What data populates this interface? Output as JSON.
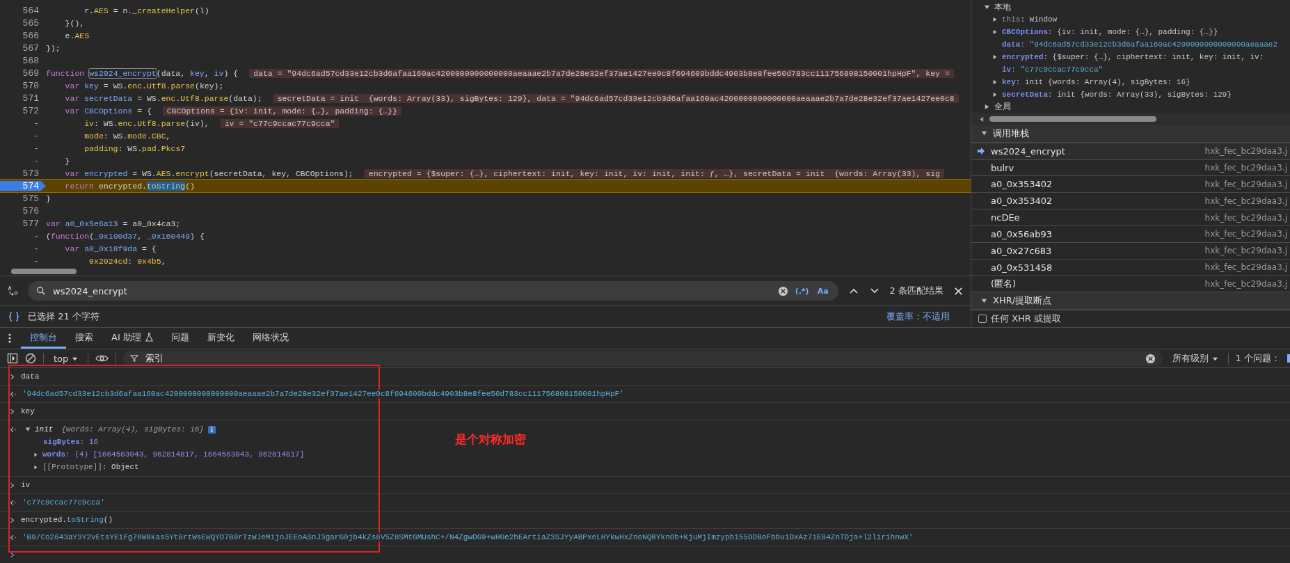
{
  "editor": {
    "lines": [
      {
        "number": "564",
        "paused": false,
        "segments": [
          {
            "text": "        r.",
            "kind": "plain"
          },
          {
            "text": "AES",
            "kind": "member"
          },
          {
            "text": " = n.",
            "kind": "plain"
          },
          {
            "text": "_createHelper",
            "kind": "member"
          },
          {
            "text": "(l)",
            "kind": "plain"
          }
        ]
      },
      {
        "number": "565",
        "paused": false,
        "segments": [
          {
            "text": "    }(),",
            "kind": "plain"
          }
        ]
      },
      {
        "number": "566",
        "paused": false,
        "segments": [
          {
            "text": "    e.",
            "kind": "plain"
          },
          {
            "text": "AES",
            "kind": "member"
          }
        ]
      },
      {
        "number": "567",
        "paused": false,
        "segments": [
          {
            "text": "});",
            "kind": "plain"
          }
        ]
      },
      {
        "number": "568",
        "paused": false
      },
      {
        "number": "569",
        "paused": false,
        "segments": [
          {
            "text": "function ",
            "kind": "keyword"
          },
          {
            "text": "ws2024_encrypt",
            "kind": "cursor"
          },
          {
            "text": "(data, ",
            "kind": "plain"
          },
          {
            "text": "key",
            "kind": "name"
          },
          {
            "text": ", ",
            "kind": "plain"
          },
          {
            "text": "iv",
            "kind": "name"
          },
          {
            "text": ") {",
            "kind": "plain"
          }
        ],
        "inline_value": "data = \"94dc6ad57cd33e12cb3d6afaa160ac4200000000000000aeaaae2b7a7de28e32ef37ae1427ee0c8f694609bddc4903b8e8fee50d783cc111756808150001hpHpF\", key ="
      },
      {
        "number": "570",
        "paused": false,
        "segments": [
          {
            "text": "    var ",
            "kind": "keyword"
          },
          {
            "text": "key",
            "kind": "name"
          },
          {
            "text": " = WS.",
            "kind": "plain"
          },
          {
            "text": "enc",
            "kind": "member"
          },
          {
            "text": ".",
            "kind": "plain"
          },
          {
            "text": "Utf8",
            "kind": "member"
          },
          {
            "text": ".",
            "kind": "plain"
          },
          {
            "text": "parse",
            "kind": "member"
          },
          {
            "text": "(key);",
            "kind": "plain"
          }
        ]
      },
      {
        "number": "571",
        "paused": false,
        "segments": [
          {
            "text": "    var ",
            "kind": "keyword"
          },
          {
            "text": "secretData",
            "kind": "name"
          },
          {
            "text": " = WS.",
            "kind": "plain"
          },
          {
            "text": "enc",
            "kind": "member"
          },
          {
            "text": ".",
            "kind": "plain"
          },
          {
            "text": "Utf8",
            "kind": "member"
          },
          {
            "text": ".",
            "kind": "plain"
          },
          {
            "text": "parse",
            "kind": "member"
          },
          {
            "text": "(data);",
            "kind": "plain"
          }
        ],
        "inline_value": "secretData = init  {words: Array(33), sigBytes: 129}, data = \"94dc6ad57cd33e12cb3d6afaa160ac4200000000000000aeaaae2b7a7de28e32ef37ae1427ee0c8"
      },
      {
        "number": "572",
        "paused": false,
        "segments": [
          {
            "text": "    var ",
            "kind": "keyword"
          },
          {
            "text": "CBCOptions",
            "kind": "name"
          },
          {
            "text": " = {",
            "kind": "plain"
          }
        ],
        "inline_value": "CBCOptions = {iv: init, mode: {…}, padding: {…}}"
      },
      {
        "number": "-",
        "paused": false,
        "segments": [
          {
            "text": "        iv",
            "kind": "member"
          },
          {
            "text": ": WS.",
            "kind": "plain"
          },
          {
            "text": "enc",
            "kind": "member"
          },
          {
            "text": ".",
            "kind": "plain"
          },
          {
            "text": "Utf8",
            "kind": "member"
          },
          {
            "text": ".",
            "kind": "plain"
          },
          {
            "text": "parse",
            "kind": "member"
          },
          {
            "text": "(iv),",
            "kind": "plain"
          }
        ],
        "inline_value": "iv = \"c77c9ccac77c9cca\""
      },
      {
        "number": "-",
        "paused": false,
        "segments": [
          {
            "text": "        mode",
            "kind": "member"
          },
          {
            "text": ": WS.",
            "kind": "plain"
          },
          {
            "text": "mode",
            "kind": "member"
          },
          {
            "text": ".",
            "kind": "plain"
          },
          {
            "text": "CBC",
            "kind": "member"
          },
          {
            "text": ",",
            "kind": "plain"
          }
        ]
      },
      {
        "number": "-",
        "paused": false,
        "segments": [
          {
            "text": "        padding",
            "kind": "member"
          },
          {
            "text": ": WS.",
            "kind": "plain"
          },
          {
            "text": "pad",
            "kind": "member"
          },
          {
            "text": ".",
            "kind": "plain"
          },
          {
            "text": "Pkcs7",
            "kind": "member"
          }
        ]
      },
      {
        "number": "-",
        "paused": false,
        "segments": [
          {
            "text": "    }",
            "kind": "plain"
          }
        ]
      },
      {
        "number": "573",
        "paused": false,
        "segments": [
          {
            "text": "    var ",
            "kind": "keyword"
          },
          {
            "text": "encrypted",
            "kind": "name"
          },
          {
            "text": " = WS.",
            "kind": "plain"
          },
          {
            "text": "AES",
            "kind": "member"
          },
          {
            "text": ".",
            "kind": "plain"
          },
          {
            "text": "encrypt",
            "kind": "member"
          },
          {
            "text": "(secretData, key, CBCOptions);",
            "kind": "plain"
          }
        ],
        "inline_value": "encrypted = {$super: {…}, ciphertext: init, key: init, iv: init, init: ƒ, …}, secretData = init  {words: Array(33), sig"
      },
      {
        "number": "574",
        "paused": true,
        "segments": [
          {
            "text": "    return ",
            "kind": "keyword"
          },
          {
            "text": "encrypted.",
            "kind": "plain"
          },
          {
            "text": "toString",
            "kind": "match"
          },
          {
            "text": "()",
            "kind": "plain"
          }
        ]
      },
      {
        "number": "575",
        "paused": false,
        "segments": [
          {
            "text": "}",
            "kind": "plain"
          }
        ]
      },
      {
        "number": "576",
        "paused": false
      },
      {
        "number": "577",
        "paused": false,
        "segments": [
          {
            "text": "var ",
            "kind": "keyword"
          },
          {
            "text": "a0_0x5e6a13",
            "kind": "name"
          },
          {
            "text": " = a0_0x4ca3;",
            "kind": "plain"
          }
        ]
      },
      {
        "number": "-",
        "paused": false,
        "segments": [
          {
            "text": "(",
            "kind": "plain"
          },
          {
            "text": "function",
            "kind": "keyword"
          },
          {
            "text": "(",
            "kind": "plain"
          },
          {
            "text": "_0x100d37",
            "kind": "name"
          },
          {
            "text": ", ",
            "kind": "plain"
          },
          {
            "text": "_0x160449",
            "kind": "name"
          },
          {
            "text": ") {",
            "kind": "plain"
          }
        ]
      },
      {
        "number": "-",
        "paused": false,
        "segments": [
          {
            "text": "    var ",
            "kind": "keyword"
          },
          {
            "text": "a0_0x18f9da",
            "kind": "name"
          },
          {
            "text": " = {",
            "kind": "plain"
          }
        ]
      },
      {
        "number": "-",
        "paused": false,
        "segments": [
          {
            "text": "         0x2024cd",
            "kind": "member"
          },
          {
            "text": ": ",
            "kind": "plain"
          },
          {
            "text": "0x4b5",
            "kind": "member"
          },
          {
            "text": ",",
            "kind": "plain"
          }
        ]
      }
    ]
  },
  "search_bar": {
    "value": "ws2024_encrypt",
    "regex_label": "(.*)",
    "case_label": "Aa",
    "result_count": "2 条匹配结果"
  },
  "status_bar": {
    "selection": "已选择 21 个字符",
    "coverage": "覆盖率：不适用"
  },
  "scope": {
    "title": "本地",
    "expanded": true,
    "variables": [
      {
        "name": "this",
        "value": ": Window",
        "expandable": true,
        "dimmed": true,
        "kind": "object"
      },
      {
        "name": "CBCOptions",
        "value": ": {iv: init, mode: {…}, padding: {…}}",
        "expandable": true,
        "dimmed": false,
        "kind": "object"
      },
      {
        "name": "data",
        "value": ": \"94dc6ad57cd33e12cb3d6afaa160ac4200000000000000aeaaae2",
        "expandable": false,
        "dimmed": false,
        "kind": "string"
      },
      {
        "name": "encrypted",
        "value": ": {$super: {…}, ciphertext: init, key: init, iv:",
        "expandable": true,
        "dimmed": false,
        "kind": "object"
      },
      {
        "name": "iv",
        "value": ": \"c77c9ccac77c9cca\"",
        "expandable": false,
        "dimmed": false,
        "kind": "string"
      },
      {
        "name": "key",
        "value": ": init  {words: Array(4), sigBytes: 16}",
        "expandable": true,
        "dimmed": false,
        "kind": "object"
      },
      {
        "name": "secretData",
        "value": ": init  {words: Array(33), sigBytes: 129}",
        "expandable": true,
        "dimmed": false,
        "kind": "object"
      }
    ],
    "global": {
      "title": "全局",
      "expanded": false
    }
  },
  "call_stack": {
    "title": "调用堆栈",
    "expanded": true,
    "frames": [
      {
        "name": "ws2024_encrypt",
        "file": "hxk_fec_bc29daa3.j",
        "selected": true
      },
      {
        "name": "bulrv",
        "file": "hxk_fec_bc29daa3.j",
        "selected": false
      },
      {
        "name": "a0_0x353402",
        "file": "hxk_fec_bc29daa3.j",
        "selected": false
      },
      {
        "name": "a0_0x353402",
        "file": "hxk_fec_bc29daa3.j",
        "selected": false
      },
      {
        "name": "ncDEe",
        "file": "hxk_fec_bc29daa3.j",
        "selected": false
      },
      {
        "name": "a0_0x56ab93",
        "file": "hxk_fec_bc29daa3.j",
        "selected": false
      },
      {
        "name": "a0_0x27c683",
        "file": "hxk_fec_bc29daa3.j",
        "selected": false
      },
      {
        "name": "a0_0x531458",
        "file": "hxk_fec_bc29daa3.j",
        "selected": false
      },
      {
        "name": "(匿名)",
        "file": "hxk_fec_bc29daa3.j",
        "selected": false
      }
    ]
  },
  "xhr_breakpoints": {
    "title": "XHR/提取断点",
    "expanded": true,
    "options": [
      {
        "label": "任何 XHR 或提取",
        "checked": false
      }
    ]
  },
  "tabs": [
    {
      "label": "控制台",
      "selected": true
    },
    {
      "label": "搜索",
      "selected": false
    },
    {
      "label": "AI 助理",
      "selected": false,
      "flask": true
    },
    {
      "label": "问题",
      "selected": false
    },
    {
      "label": "新变化",
      "selected": false
    },
    {
      "label": "网络状况",
      "selected": false
    }
  ],
  "console_toolbar": {
    "context": "top",
    "filter": "索引",
    "levels": "所有级别",
    "issues": "1 个问题："
  },
  "console": [
    {
      "kind": "input",
      "segments": [
        {
          "text": "data",
          "kind": "plain"
        }
      ]
    },
    {
      "kind": "string",
      "text": "'94dc6ad57cd33e12cb3d6afaa160ac4200000000000000aeaaae2b7a7de28e32ef37ae1427ee0c8f694609bddc4903b8e8fee50d783cc111756808150001hpHpF'"
    },
    {
      "kind": "input",
      "segments": [
        {
          "text": "key",
          "kind": "plain"
        }
      ]
    },
    {
      "kind": "object",
      "title": "init",
      "preview": "{words: Array(4), sigBytes: 16}",
      "expanded": true,
      "children": [
        {
          "name": "sigBytes",
          "value": ": 16",
          "expandable": false,
          "internal": false
        },
        {
          "name": "words",
          "value": ": (4)  [1664563043, 962814817, 1664563043, 962814817]",
          "expandable": true,
          "internal": false
        },
        {
          "name": "[[Prototype]]",
          "value": ": Object",
          "expandable": true,
          "internal": true
        }
      ]
    },
    {
      "kind": "input",
      "segments": [
        {
          "text": "iv",
          "kind": "plain"
        }
      ]
    },
    {
      "kind": "string",
      "text": "'c77c9ccac77c9cca'"
    },
    {
      "kind": "input",
      "segments": [
        {
          "text": "encrypted.",
          "kind": "plain"
        },
        {
          "text": "toString",
          "kind": "method"
        },
        {
          "text": "()",
          "kind": "plain"
        }
      ]
    },
    {
      "kind": "string",
      "text": "'B9/Co2643aY3Y2vEtsYEiFg70W0kas5Yt6rtWsEwQYD7B0rTzWJeMijoJEEoASnJ3garG0jb4kZs6V5Z8SMtGMUshC+/N4ZgwDG9+wHGe2hEArtiaZ3SJYyABPxeLHYkwHxZnoNQRYknOb+KjuMjImzypb155ODBoFbbu1DxAz7iE84ZnTDja+l2lirihnwX'"
    },
    {
      "kind": "prompt"
    }
  ],
  "annotation": {
    "text": "是个对称加密"
  }
}
